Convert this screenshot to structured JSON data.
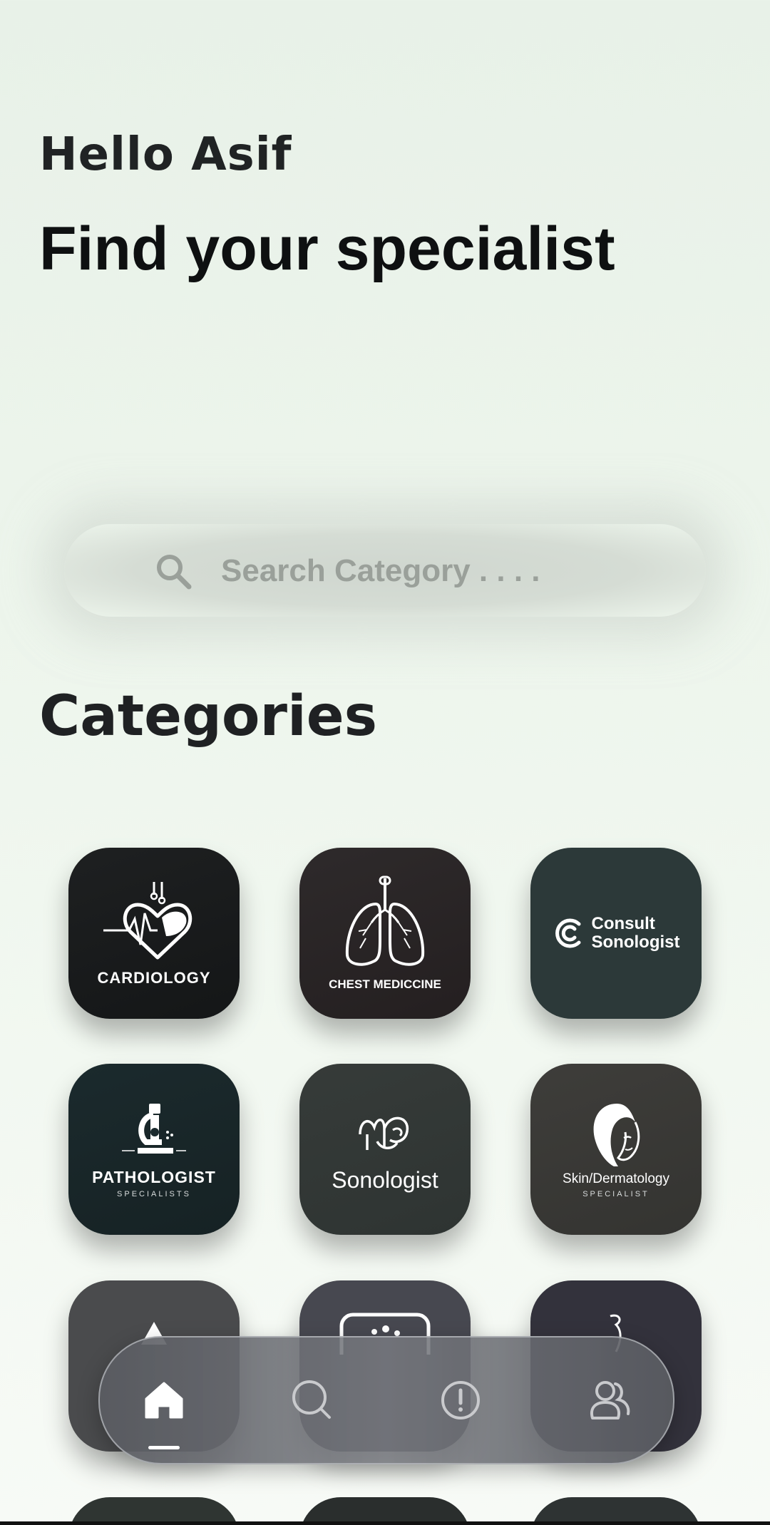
{
  "header": {
    "greeting": "Hello Asif",
    "title": "Find your specialist"
  },
  "search": {
    "placeholder": "Search Category . . . ."
  },
  "categories_title": "Categories",
  "categories": [
    {
      "label": "CARDIOLOGY",
      "icon": "heart-icon",
      "bg": "#191b1c"
    },
    {
      "label": "CHEST MEDICCINE",
      "icon": "lungs-icon",
      "bg": "#2a2627"
    },
    {
      "label": "Consult Sonologist",
      "icon": "consult-logo-icon",
      "bg": "#2c3939"
    },
    {
      "label": "PATHOLOGIST",
      "sub": "SPECIALISTS",
      "icon": "microscope-icon",
      "bg": "#1a2628"
    },
    {
      "label": "Sonologist",
      "icon": "ultrasound-icon",
      "bg": "#323836"
    },
    {
      "label": "Skin/Dermatology",
      "sub": "SPECIALIST",
      "icon": "face-icon",
      "bg": "#3a3a38"
    }
  ],
  "nav": {
    "items": [
      {
        "name": "home",
        "icon": "home-icon",
        "active": true
      },
      {
        "name": "search",
        "icon": "search-icon"
      },
      {
        "name": "alerts",
        "icon": "alert-icon"
      },
      {
        "name": "profile",
        "icon": "users-icon"
      }
    ]
  },
  "colors": {
    "accent": "#ffffff",
    "background": "#edf5ec"
  }
}
